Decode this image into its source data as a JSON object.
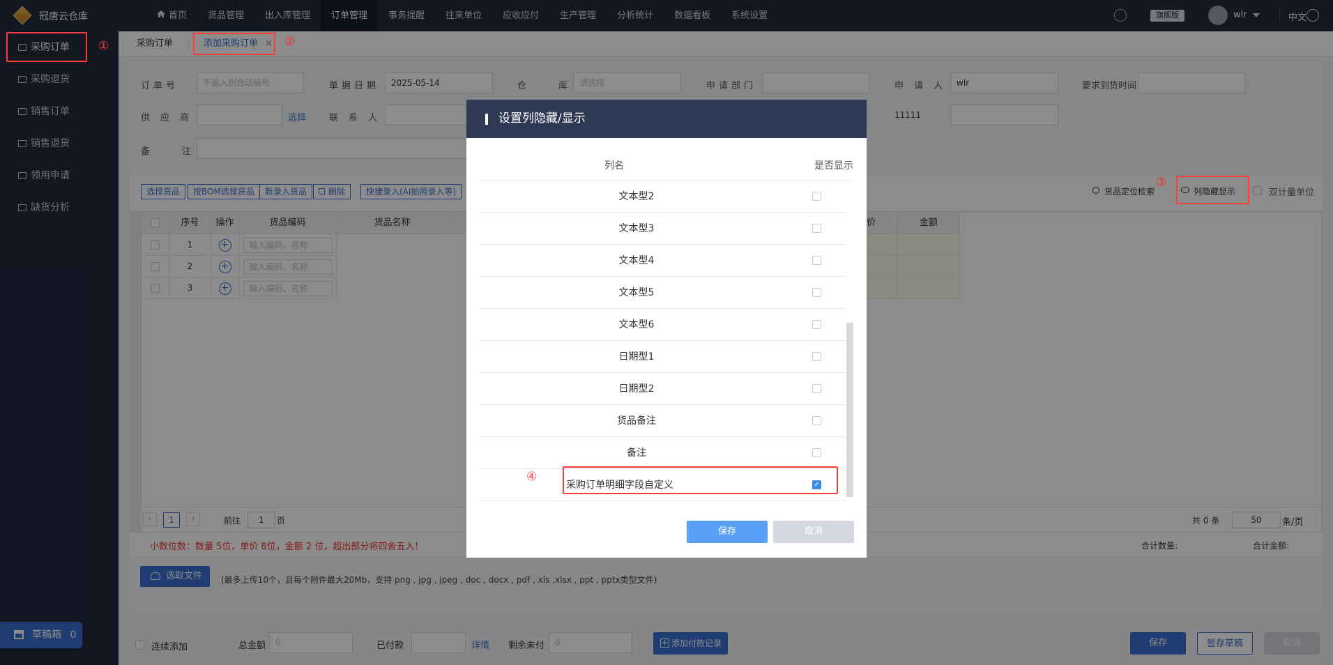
{
  "app": {
    "brand": "冠唐云仓库",
    "edition": "旗舰版",
    "user": "wlr",
    "lang": "中文"
  },
  "nav": [
    "首页",
    "货品管理",
    "出入库管理",
    "订单管理",
    "事务提醒",
    "往来单位",
    "应收应付",
    "生产管理",
    "分析统计",
    "数据看板",
    "系统设置"
  ],
  "sidebar": [
    "采购订单",
    "采购退货",
    "销售订单",
    "销售退货",
    "领用申请",
    "缺货分析"
  ],
  "draft": {
    "label": "草稿箱",
    "count": "0"
  },
  "annotations": [
    "①",
    "②",
    "③",
    "④"
  ],
  "tabs": {
    "first": "采购订单",
    "active": "添加采购订单",
    "close": "×"
  },
  "form": {
    "order_no": {
      "label": "订单号",
      "placeholder": "不输入则自动编号"
    },
    "date": {
      "label": "单据日期",
      "value": "2025-05-14"
    },
    "warehouse": {
      "label": "仓库",
      "placeholder": "请选择"
    },
    "dept": {
      "label": "申请部门"
    },
    "applicant": {
      "label": "申请人",
      "value": "wlr"
    },
    "arrival": {
      "label": "要求到货时间"
    },
    "supplier": {
      "label": "供应商",
      "select": "选择"
    },
    "contact": {
      "label": "联系人"
    },
    "phone_value": "11111",
    "remark": {
      "label": "备注"
    }
  },
  "toolbar": {
    "buttons": [
      "选择货品",
      "按BOM选择货品",
      "新录入货品",
      "删除"
    ],
    "quick": "快捷录入(AI拍照录入等)",
    "locate": "货品定位检索",
    "toggle_cols": "列隐藏显示",
    "dual_unit": "双计量单位"
  },
  "grid": {
    "headers": [
      "序号",
      "操作",
      "货品编码",
      "货品名称"
    ],
    "right_headers": [
      "价",
      "金额"
    ],
    "rows": [
      "1",
      "2",
      "3"
    ],
    "code_placeholder": "输入编码、名称"
  },
  "pager": {
    "page": "1",
    "goto": "前往",
    "goto_val": "1",
    "page_suffix": "页",
    "total": "共 0 条",
    "size": "50",
    "size_suffix": "条/页"
  },
  "notice": "小数位数：数量 5位，单价 8位，金额 2 位，超出部分将四舍五入！",
  "totals": {
    "qty": "合计数量:",
    "amount": "合计金额:"
  },
  "upload": {
    "button": "选取文件",
    "hint": "(最多上传10个，且每个附件最大20Mb，支持 png , jpg , jpeg , doc , docx , pdf , xls ,xlsx , ppt , pptx类型文件)"
  },
  "footer": {
    "continuous": "连续添加",
    "total_amount": "总金额",
    "total_val": "0",
    "paid": "已付款",
    "detail": "详情",
    "remaining": "剩余未付",
    "remaining_val": "0",
    "add_payment": "添加付款记录",
    "save": "保存",
    "draft": "暂存草稿",
    "cancel": "取消"
  },
  "modal": {
    "title": "设置列隐藏/显示",
    "col_name": "列名",
    "col_show": "是否显示",
    "rows": [
      {
        "name": "文本型2",
        "checked": false
      },
      {
        "name": "文本型3",
        "checked": false
      },
      {
        "name": "文本型4",
        "checked": false
      },
      {
        "name": "文本型5",
        "checked": false
      },
      {
        "name": "文本型6",
        "checked": false
      },
      {
        "name": "日期型1",
        "checked": false
      },
      {
        "name": "日期型2",
        "checked": false
      },
      {
        "name": "货品备注",
        "checked": false
      },
      {
        "name": "备注",
        "checked": false
      },
      {
        "name": "采购订单明细字段自定义",
        "checked": true
      }
    ],
    "save": "保存",
    "cancel": "取消"
  },
  "colors": {
    "topbar": "#222a3f",
    "accent": "#3a6fd0",
    "alert": "#e33",
    "modal_head": "#2e3a54"
  }
}
